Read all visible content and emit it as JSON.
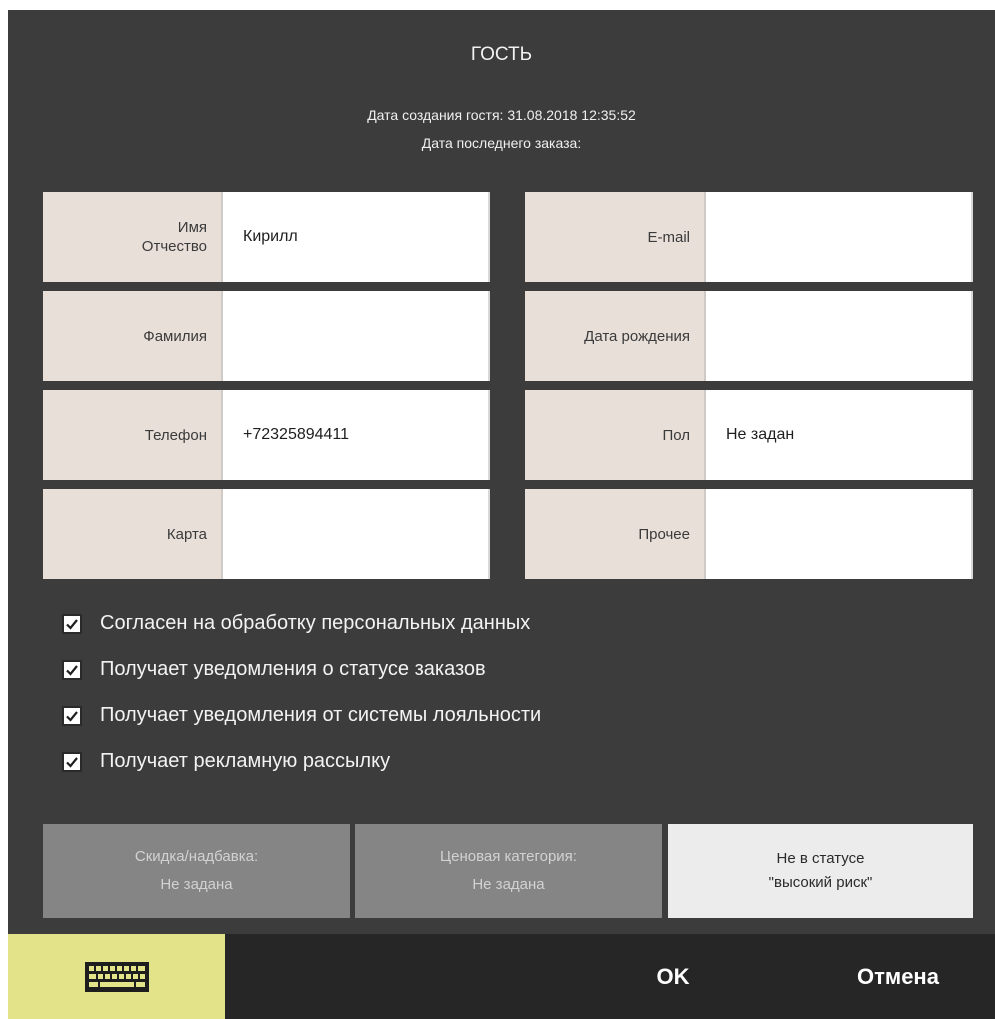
{
  "dialog": {
    "title": "ГОСТЬ",
    "created_line": "Дата создания гостя: 31.08.2018 12:35:52",
    "last_order_line": "Дата последнего заказа:"
  },
  "fields": {
    "first_name": {
      "label_1": "Имя",
      "label_2": "Отчество",
      "value": "Кирилл"
    },
    "last_name": {
      "label": "Фамилия",
      "value": ""
    },
    "phone": {
      "label": "Телефон",
      "value": "+72325894411"
    },
    "card": {
      "label": "Карта",
      "value": ""
    },
    "email": {
      "label": "E-mail",
      "value": ""
    },
    "birthday": {
      "label": "Дата рождения",
      "value": ""
    },
    "gender": {
      "label": "Пол",
      "value": "Не задан"
    },
    "other": {
      "label": "Прочее",
      "value": ""
    }
  },
  "checkboxes": [
    {
      "label": "Согласен на обработку персональных данных",
      "checked": true
    },
    {
      "label": "Получает уведомления о статусе заказов",
      "checked": true
    },
    {
      "label": "Получает уведомления от системы лояльности",
      "checked": true
    },
    {
      "label": "Получает рекламную рассылку",
      "checked": true
    }
  ],
  "buttons": {
    "discount": {
      "line1": "Скидка/надбавка:",
      "line2": "Не задана"
    },
    "price_category": {
      "line1": "Ценовая категория:",
      "line2": "Не задана"
    },
    "risk": {
      "line1": "Не в статусе",
      "line2": "\"высокий риск\""
    }
  },
  "footer": {
    "keyboard_icon": "keyboard-icon",
    "ok_label": "OK",
    "cancel_label": "Отмена"
  },
  "colors": {
    "background": "#3b3c3b",
    "label_bg": "#e8dfd9",
    "footer_bg": "#262626",
    "keyboard_bg": "#e3e48a",
    "disabled_button_bg": "#858585",
    "light_button_bg": "#ececec"
  }
}
